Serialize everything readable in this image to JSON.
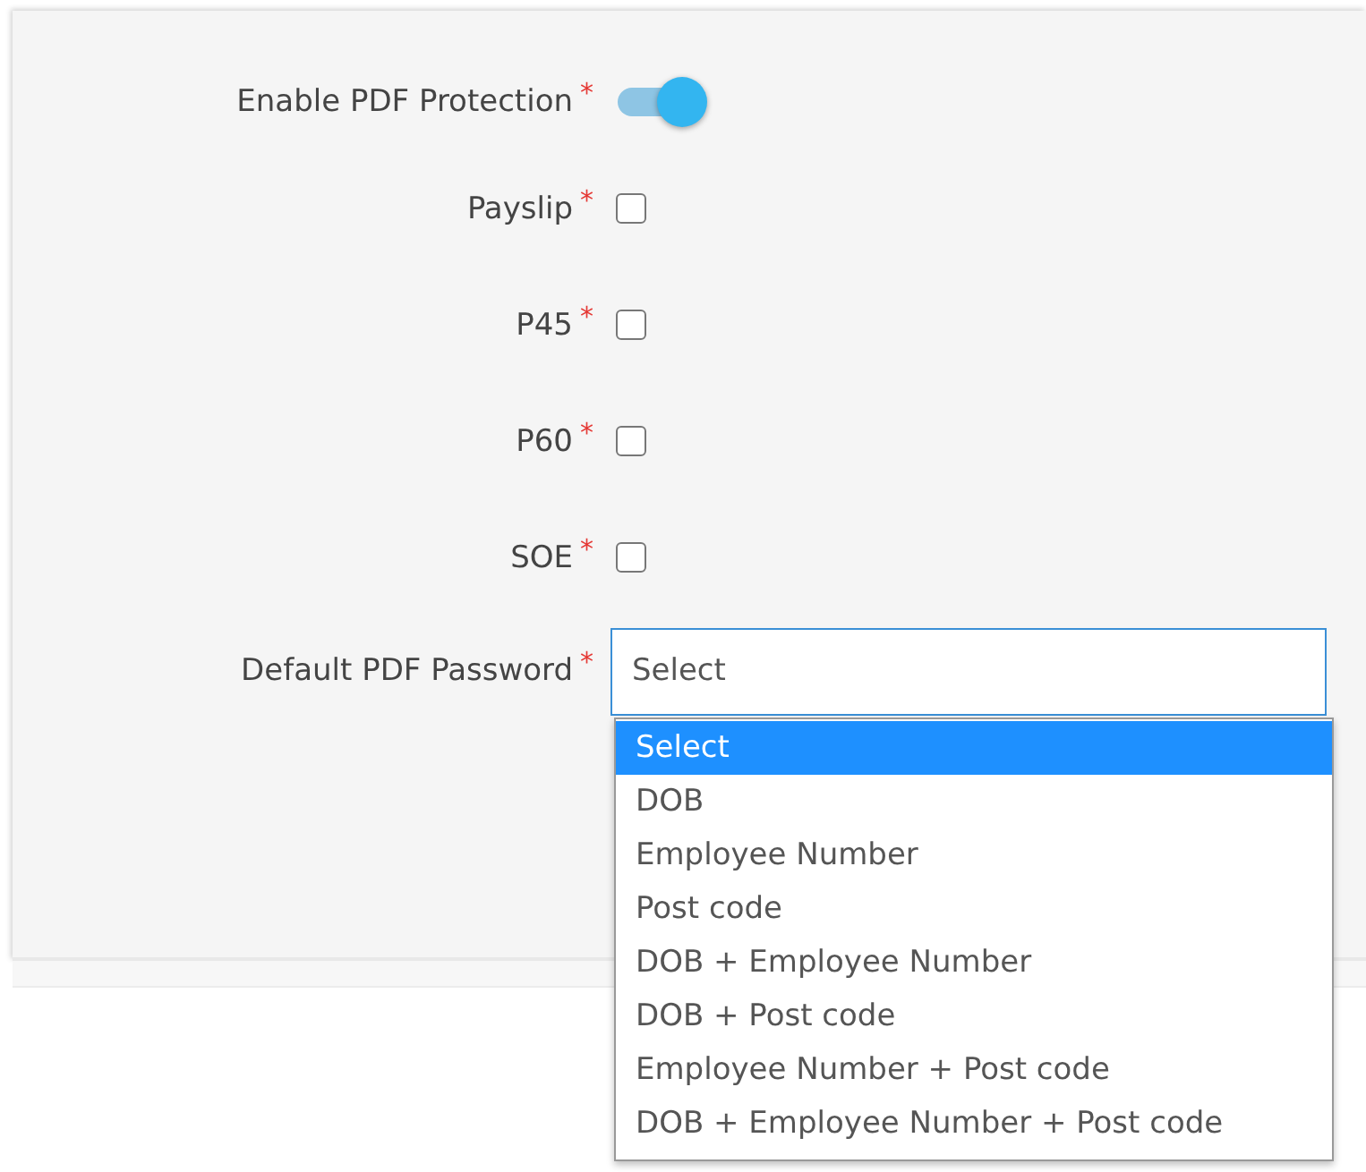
{
  "fields": [
    {
      "kind": "toggle",
      "label": "Enable PDF Protection",
      "required": "*",
      "on": true
    },
    {
      "kind": "checkbox",
      "label": "Payslip",
      "required": "*",
      "checked": false
    },
    {
      "kind": "checkbox",
      "label": "P45",
      "required": "*",
      "checked": false
    },
    {
      "kind": "checkbox",
      "label": "P60",
      "required": "*",
      "checked": false
    },
    {
      "kind": "checkbox",
      "label": "SOE",
      "required": "*",
      "checked": false
    },
    {
      "kind": "select",
      "label": "Default PDF Password",
      "required": "*",
      "value": "Select",
      "expanded": true,
      "options": [
        {
          "label": "Select",
          "selected": true
        },
        {
          "label": "DOB",
          "selected": false
        },
        {
          "label": "Employee Number",
          "selected": false
        },
        {
          "label": "Post code",
          "selected": false
        },
        {
          "label": "DOB + Employee Number",
          "selected": false
        },
        {
          "label": "DOB + Post code",
          "selected": false
        },
        {
          "label": "Employee Number + Post code",
          "selected": false
        },
        {
          "label": "DOB + Employee Number + Post code",
          "selected": false
        }
      ]
    }
  ]
}
